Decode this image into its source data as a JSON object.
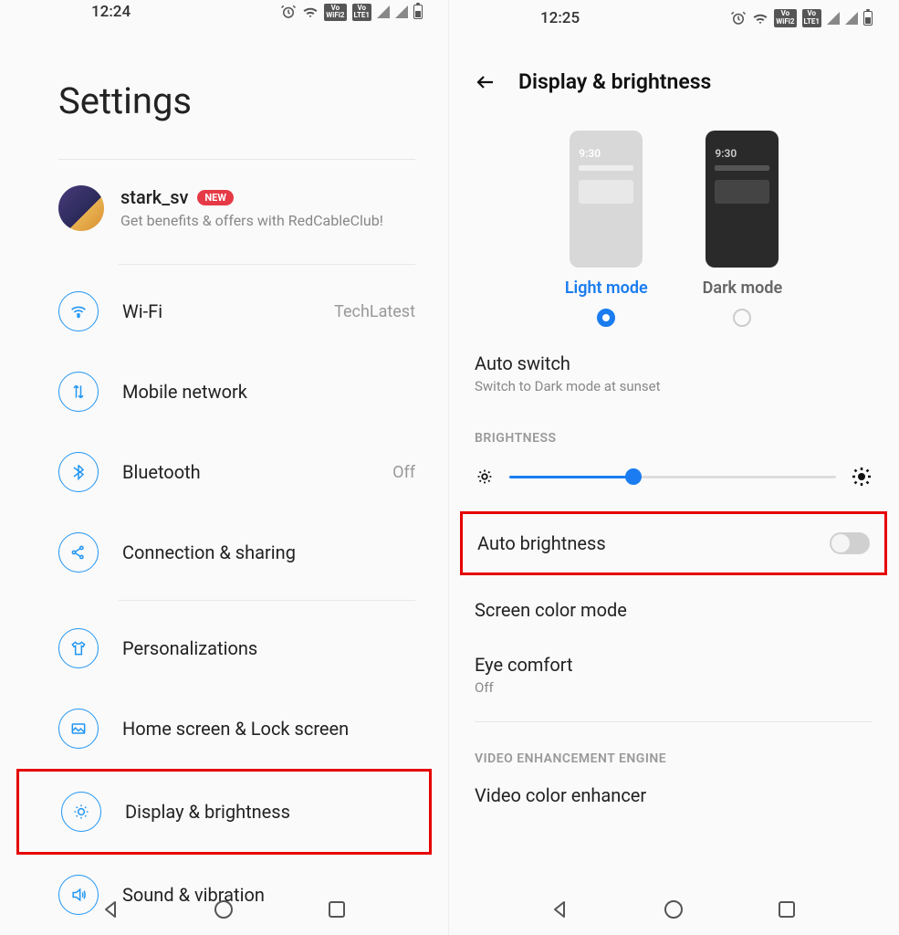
{
  "left": {
    "status_time": "12:24",
    "page_title": "Settings",
    "profile": {
      "name": "stark_sv",
      "badge": "NEW",
      "subtitle": "Get benefits & offers with RedCableClub!"
    },
    "items": [
      {
        "label": "Wi-Fi",
        "value": "TechLatest"
      },
      {
        "label": "Mobile network",
        "value": ""
      },
      {
        "label": "Bluetooth",
        "value": "Off"
      },
      {
        "label": "Connection & sharing",
        "value": ""
      },
      {
        "label": "Personalizations",
        "value": ""
      },
      {
        "label": "Home screen & Lock screen",
        "value": ""
      },
      {
        "label": "Display & brightness",
        "value": ""
      },
      {
        "label": "Sound & vibration",
        "value": ""
      }
    ]
  },
  "right": {
    "status_time": "12:25",
    "header_title": "Display & brightness",
    "themes": {
      "mock_time": "9:30",
      "light_label": "Light mode",
      "dark_label": "Dark mode",
      "selected": "light"
    },
    "auto_switch": {
      "title": "Auto switch",
      "subtitle": "Switch to Dark mode at sunset"
    },
    "brightness_header": "BRIGHTNESS",
    "brightness_percent": 38,
    "auto_brightness_label": "Auto brightness",
    "auto_brightness_on": false,
    "screen_color_label": "Screen color mode",
    "eye_comfort": {
      "title": "Eye comfort",
      "subtitle": "Off"
    },
    "video_header": "VIDEO ENHANCEMENT ENGINE",
    "video_enhancer_label": "Video color enhancer"
  },
  "status_badges": {
    "vowifi": "Vo\nWiFi2",
    "volte": "Vo\nLTE1"
  }
}
